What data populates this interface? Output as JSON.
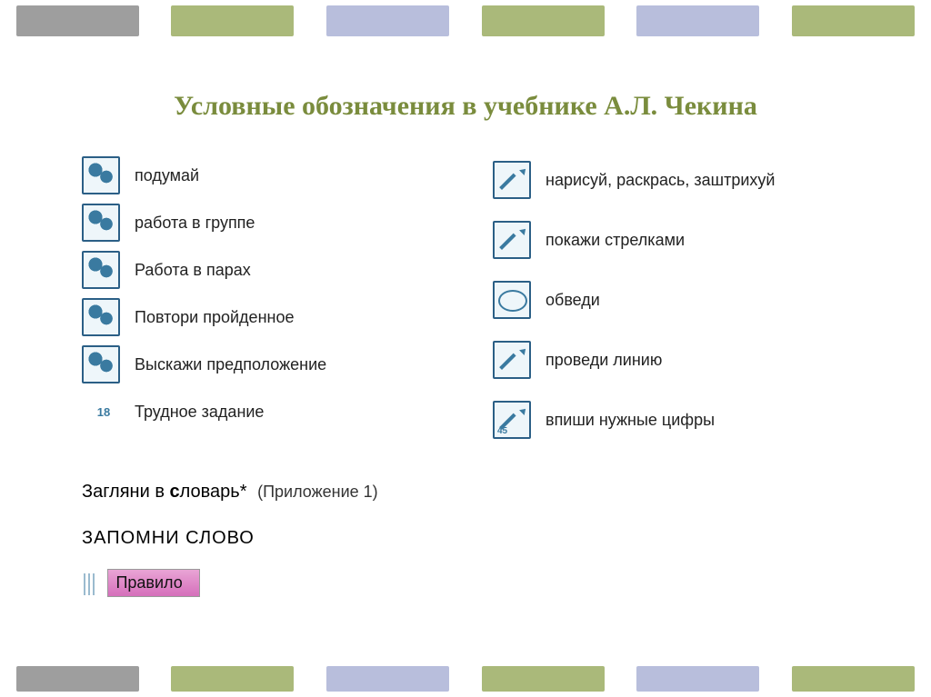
{
  "title": "Условные обозначения в учебнике А.Л. Чекина",
  "left_items": [
    {
      "icon": "thinking",
      "label": "подумай"
    },
    {
      "icon": "group",
      "label": "работа в группе"
    },
    {
      "icon": "pair",
      "label": "Работа в парах"
    },
    {
      "icon": "repeat",
      "label": "Повтори пройденное"
    },
    {
      "icon": "speak",
      "label": "Выскажи предположение"
    }
  ],
  "left_number_item": {
    "num": "18",
    "label": "Трудное задание"
  },
  "right_items": [
    {
      "icon": "pencil",
      "label": "нарисуй, раскрась, заштрихуй"
    },
    {
      "icon": "arrows",
      "label": "покажи стрелками"
    },
    {
      "icon": "circle",
      "label": "обведи"
    },
    {
      "icon": "line",
      "label": "проведи линию"
    },
    {
      "icon": "digits",
      "label": "впиши нужные цифры",
      "digits": "45"
    }
  ],
  "below": {
    "lookup_prefix": "Загляни в ",
    "lookup_bold": "с",
    "lookup_rest": "ловарь*",
    "appendix": "(Приложение 1)",
    "remember": "ЗАПОМНИ СЛОВО",
    "rule": "Правило"
  }
}
